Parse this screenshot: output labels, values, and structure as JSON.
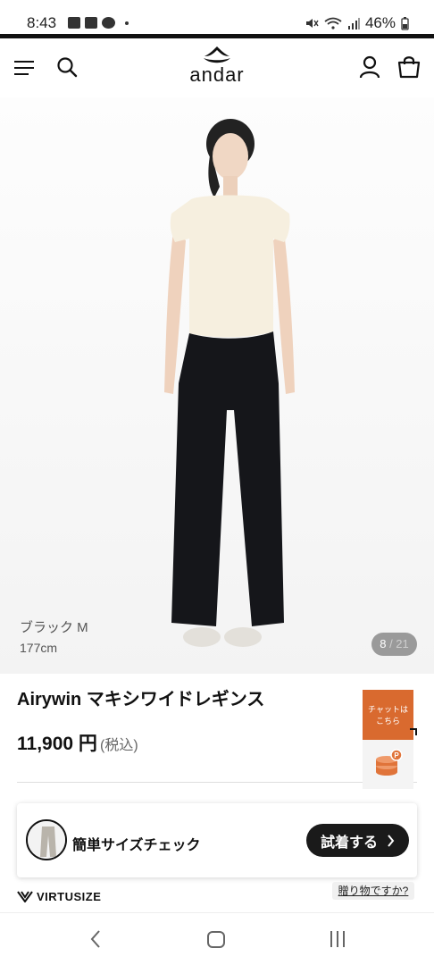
{
  "status_bar": {
    "time": "8:43",
    "battery": "46%",
    "icons": [
      "image-icon",
      "news-icon",
      "line-icon",
      "mute-icon",
      "wifi-icon",
      "signal-icon",
      "battery-icon"
    ]
  },
  "header": {
    "logo_text": "andar",
    "icons": [
      "menu-icon",
      "search-icon",
      "user-icon",
      "shopping-bag-icon"
    ]
  },
  "hero": {
    "variant": "ブラック M",
    "model_height": "177cm",
    "page_current": "8",
    "page_total": "21"
  },
  "product": {
    "title": "Airywin マキシワイドレギンス",
    "price": "11,900 円",
    "tax_note": "(税込)"
  },
  "chat": {
    "line1": "チャットは",
    "line2": "こちら"
  },
  "size_check": {
    "label": "簡単サイズチェック",
    "button": "試着する"
  },
  "virtusize": {
    "brand": "VIRTUSIZE"
  },
  "gift_link": "贈り物ですか?",
  "colors": {
    "chat_orange": "#d96a2f",
    "point_orange": "#e0743a",
    "button_dark": "#1a1a1a"
  }
}
